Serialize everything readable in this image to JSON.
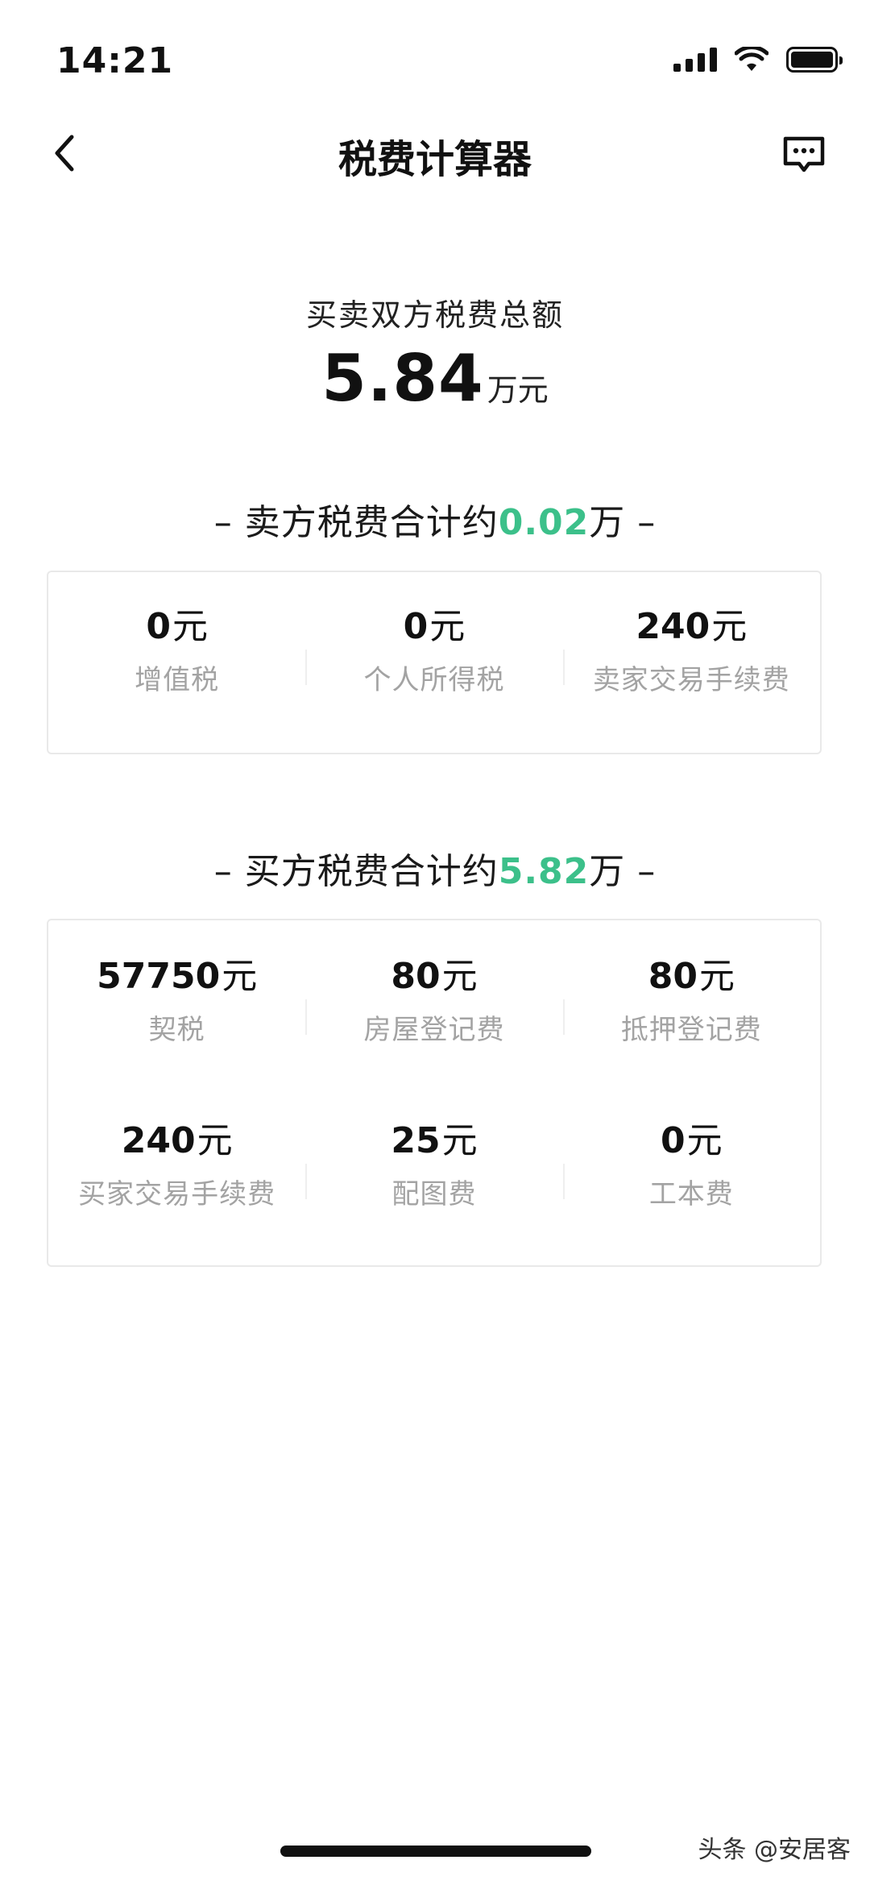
{
  "status_bar": {
    "time": "14:21"
  },
  "nav": {
    "title": "税费计算器",
    "back_icon": "chevron-left-icon",
    "feedback_icon": "message-dots-icon"
  },
  "total": {
    "label": "买卖双方税费总额",
    "value": "5.84",
    "unit": "万元"
  },
  "seller": {
    "header_prefix": "卖方税费合计约",
    "header_amount": "0.02",
    "header_suffix": "万",
    "items": [
      {
        "value": "0",
        "unit": "元",
        "label": "增值税"
      },
      {
        "value": "0",
        "unit": "元",
        "label": "个人所得税"
      },
      {
        "value": "240",
        "unit": "元",
        "label": "卖家交易手续费"
      }
    ]
  },
  "buyer": {
    "header_prefix": "买方税费合计约",
    "header_amount": "5.82",
    "header_suffix": "万",
    "items": [
      {
        "value": "57750",
        "unit": "元",
        "label": "契税"
      },
      {
        "value": "80",
        "unit": "元",
        "label": "房屋登记费"
      },
      {
        "value": "80",
        "unit": "元",
        "label": "抵押登记费"
      },
      {
        "value": "240",
        "unit": "元",
        "label": "买家交易手续费"
      },
      {
        "value": "25",
        "unit": "元",
        "label": "配图费"
      },
      {
        "value": "0",
        "unit": "元",
        "label": "工本费"
      }
    ]
  },
  "watermark": "头条 @安居客",
  "colors": {
    "accent": "#3cc08a",
    "label_gray": "#a3a3a3",
    "card_border": "#e9e9e9"
  }
}
